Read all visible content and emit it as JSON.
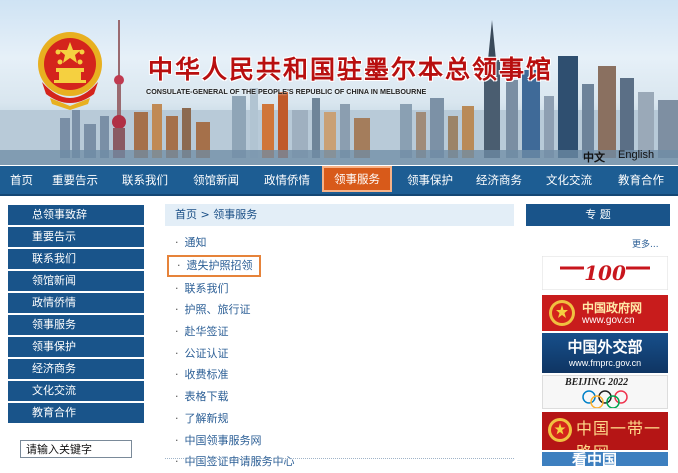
{
  "header": {
    "title_cn": "中华人民共和国驻墨尔本总领事馆",
    "title_en": "CONSULATE-GENERAL OF THE PEOPLE'S REPUBLIC OF CHINA IN MELBOURNE",
    "lang_cn": "中文",
    "lang_en": "English"
  },
  "nav": {
    "items": [
      {
        "label": "首页"
      },
      {
        "label": "重要告示"
      },
      {
        "label": "联系我们"
      },
      {
        "label": "领馆新闻"
      },
      {
        "label": "政情侨情"
      },
      {
        "label": "领事服务",
        "active": true
      },
      {
        "label": "领事保护"
      },
      {
        "label": "经济商务"
      },
      {
        "label": "文化交流"
      },
      {
        "label": "教育合作"
      }
    ]
  },
  "sidebar": {
    "items": [
      {
        "label": "总领事致辞"
      },
      {
        "label": "重要告示"
      },
      {
        "label": "联系我们"
      },
      {
        "label": "领馆新闻"
      },
      {
        "label": "政情侨情"
      },
      {
        "label": "领事服务"
      },
      {
        "label": "领事保护"
      },
      {
        "label": "经济商务"
      },
      {
        "label": "文化交流"
      },
      {
        "label": "教育合作"
      }
    ],
    "search_placeholder": "请输入关键字"
  },
  "breadcrumb": {
    "home": "首页",
    "separator": " > ",
    "current": "领事服务"
  },
  "list": {
    "bullet": "·",
    "items": [
      {
        "label": "通知"
      },
      {
        "label": "遗失护照招领",
        "highlighted": true
      },
      {
        "label": "联系我们"
      },
      {
        "label": "护照、旅行证"
      },
      {
        "label": "赴华签证"
      },
      {
        "label": "公证认证"
      },
      {
        "label": "收费标准"
      },
      {
        "label": "表格下载"
      },
      {
        "label": "了解新规"
      },
      {
        "label": "中国领事服务网"
      },
      {
        "label": "中国签证申请服务中心"
      }
    ]
  },
  "right": {
    "title": "专 题",
    "more": "更多...",
    "tiles": {
      "anniversary_text": "100",
      "gov_title": "中国政府网",
      "gov_url": "www.gov.cn",
      "mfa_title": "中国外交部",
      "mfa_url": "www.fmprc.gov.cn",
      "olympics_text": "BEIJING 2022",
      "belt_text": "中国一带一路网",
      "bottom_text": "看中国"
    }
  },
  "colors": {
    "nav_blue": "#1d5d93",
    "sidebar_blue": "#19548a",
    "active_orange": "#d85a1a",
    "title_red": "#b80f0f",
    "highlight_border": "#e6833a"
  }
}
